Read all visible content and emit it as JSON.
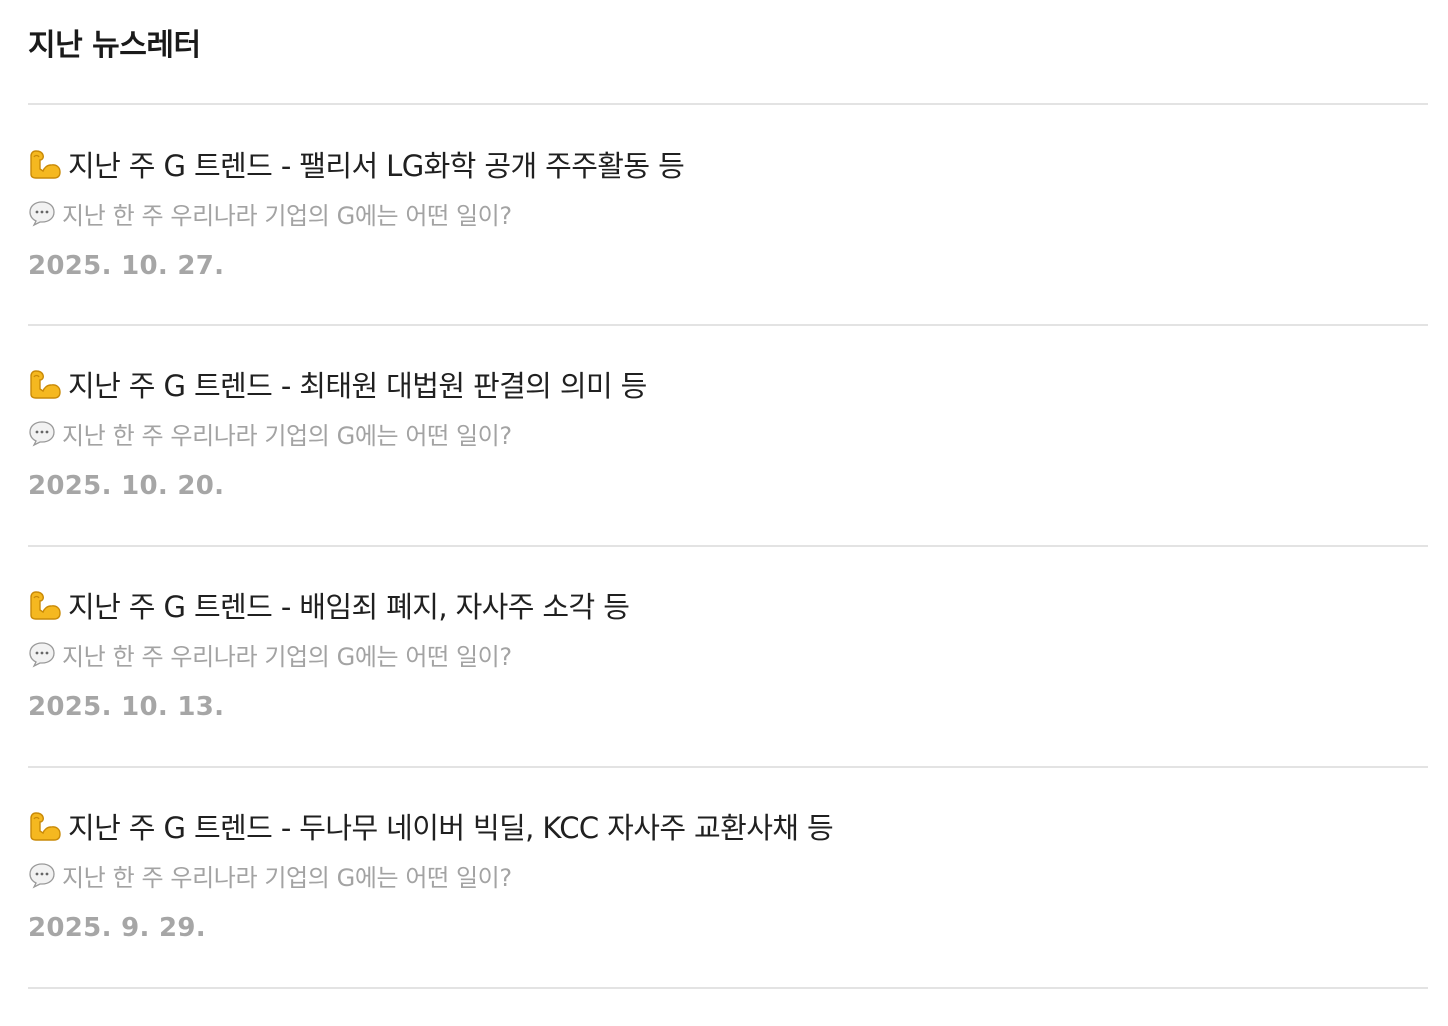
{
  "page": {
    "title": "지난 뉴스레터"
  },
  "icons": {
    "title_icon": "flexed-biceps-icon",
    "subtitle_icon": "speech-bubble-icon"
  },
  "newsletters": [
    {
      "title": "지난 주 G 트렌드 - 팰리서 LG화학 공개 주주활동 등",
      "subtitle": "지난 한 주 우리나라 기업의 G에는 어떤 일이?",
      "date": "2025. 10. 27."
    },
    {
      "title": "지난 주 G 트렌드 - 최태원 대법원 판결의 의미 등",
      "subtitle": "지난 한 주 우리나라 기업의 G에는 어떤 일이?",
      "date": "2025. 10. 20."
    },
    {
      "title": "지난 주 G 트렌드 - 배임죄 폐지, 자사주 소각 등",
      "subtitle": "지난 한 주 우리나라 기업의 G에는 어떤 일이?",
      "date": "2025. 10. 13."
    },
    {
      "title": "지난 주 G 트렌드 - 두나무 네이버 빅딜, KCC 자사주 교환사채 등",
      "subtitle": "지난 한 주 우리나라 기업의 G에는 어떤 일이?",
      "date": "2025. 9. 29."
    }
  ]
}
